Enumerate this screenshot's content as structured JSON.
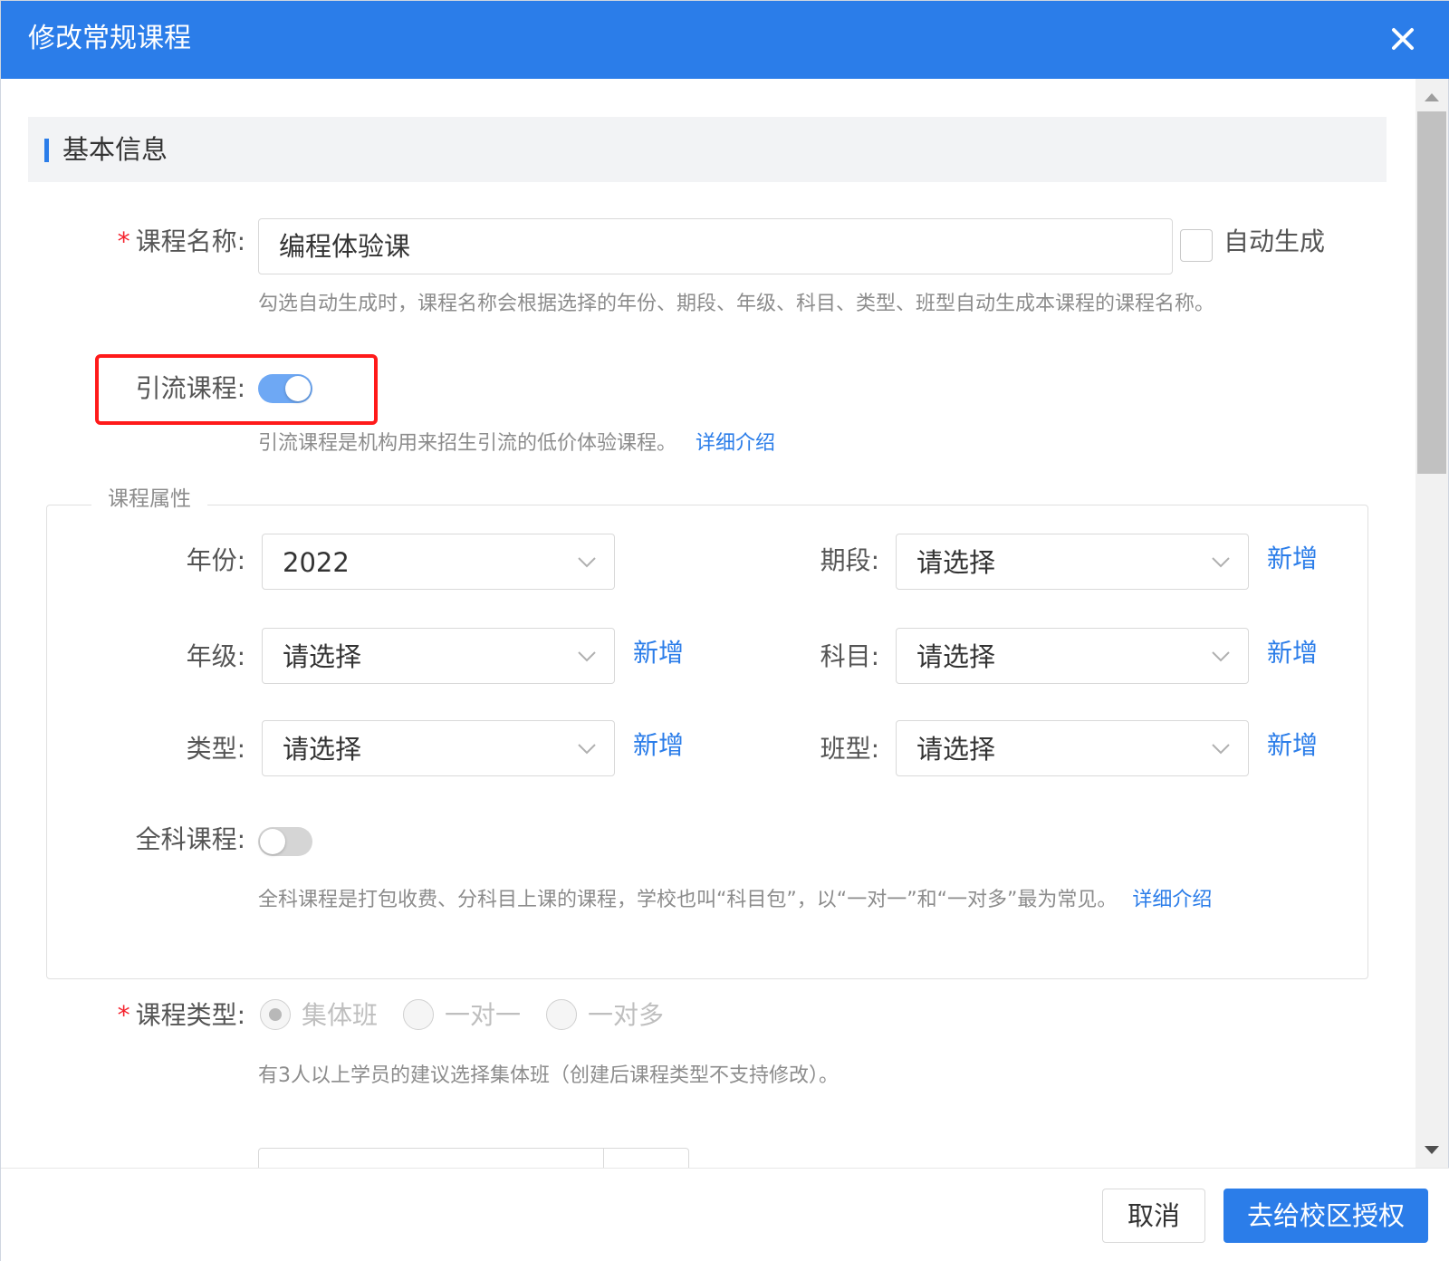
{
  "dialog": {
    "title": "修改常规课程",
    "close_icon": "close-icon"
  },
  "basic_section": {
    "title": "基本信息"
  },
  "course_name": {
    "required_mark": "*",
    "label": "课程名称:",
    "value": "编程体验课",
    "auto_generate_label": "自动生成",
    "auto_generate_checked": false,
    "hint": "勾选自动生成时，课程名称会根据选择的年份、期段、年级、科目、类型、班型自动生成本课程的课程名称。"
  },
  "lead_course": {
    "label": "引流课程:",
    "enabled": true,
    "hint": "引流课程是机构用来招生引流的低价体验课程。",
    "detail_link": "详细介绍"
  },
  "attributes": {
    "legend": "课程属性",
    "year": {
      "label": "年份:",
      "value": "2022"
    },
    "period": {
      "label": "期段:",
      "value": "请选择",
      "add": "新增"
    },
    "grade": {
      "label": "年级:",
      "value": "请选择",
      "add": "新增"
    },
    "subject": {
      "label": "科目:",
      "value": "请选择",
      "add": "新增"
    },
    "type": {
      "label": "类型:",
      "value": "请选择",
      "add": "新增"
    },
    "class_type": {
      "label": "班型:",
      "value": "请选择",
      "add": "新增"
    },
    "full_subject": {
      "label": "全科课程:",
      "enabled": false,
      "hint": "全科课程是打包收费、分科目上课的课程，学校也叫“科目包”，以“一对一”和“一对多”最为常见。",
      "detail_link": "详细介绍"
    }
  },
  "course_type": {
    "required_mark": "*",
    "label": "课程类型:",
    "options": [
      "集体班",
      "一对一",
      "一对多"
    ],
    "selected": "集体班",
    "hint": "有3人以上学员的建议选择集体班（创建后课程类型不支持修改）。"
  },
  "footer": {
    "cancel_label": "取消",
    "primary_label": "去给校区授权"
  },
  "colors": {
    "primary": "#2b7de9",
    "required": "#f5222d",
    "highlight_box": "#ff1a1a"
  }
}
